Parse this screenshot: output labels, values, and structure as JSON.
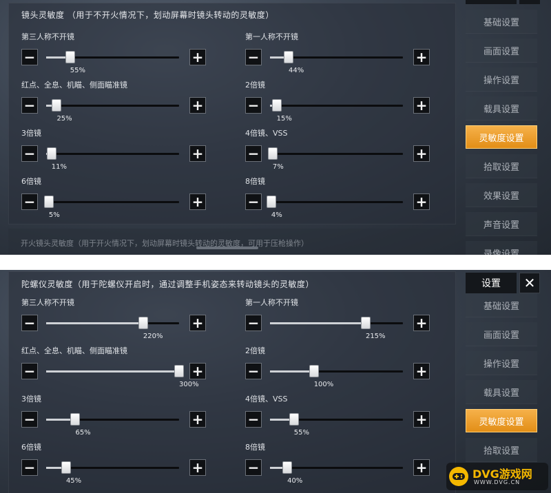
{
  "panel1": {
    "section_title": "镜头灵敏度  （用于不开火情况下，划动屏幕时镜头转动的灵敏度）",
    "next_section_title": "开火镜头灵敏度（用于开火情况下，划动屏幕时镜头转动的灵敏度，可用于压枪操作）",
    "settings": [
      {
        "label": "第三人称不开镜",
        "value": "55%",
        "level": 0.18
      },
      {
        "label": "第一人称不开镜",
        "value": "44%",
        "level": 0.14
      },
      {
        "label": "红点、全息、机瞄、侧面瞄准镜",
        "value": "25%",
        "level": 0.08
      },
      {
        "label": "2倍镜",
        "value": "15%",
        "level": 0.05
      },
      {
        "label": "3倍镜",
        "value": "11%",
        "level": 0.04
      },
      {
        "label": "4倍镜、VSS",
        "value": "7%",
        "level": 0.02
      },
      {
        "label": "6倍镜",
        "value": "5%",
        "level": 0.02
      },
      {
        "label": "8倍镜",
        "value": "4%",
        "level": 0.01
      }
    ],
    "sidebar": [
      {
        "label": "基础设置",
        "active": false
      },
      {
        "label": "画面设置",
        "active": false
      },
      {
        "label": "操作设置",
        "active": false
      },
      {
        "label": "载具设置",
        "active": false
      },
      {
        "label": "灵敏度设置",
        "active": true
      },
      {
        "label": "拾取设置",
        "active": false
      },
      {
        "label": "效果设置",
        "active": false
      },
      {
        "label": "声音设置",
        "active": false
      },
      {
        "label": "录像设置",
        "active": false
      }
    ]
  },
  "panel2": {
    "section_title": "陀螺仪灵敏度（用于陀螺仪开启时，通过调整手机姿态来转动镜头的灵敏度）",
    "header_title": "设置",
    "close_label": "✕",
    "settings": [
      {
        "label": "第三人称不开镜",
        "value": "220%",
        "level": 0.73
      },
      {
        "label": "第一人称不开镜",
        "value": "215%",
        "level": 0.72
      },
      {
        "label": "红点、全息、机瞄、侧面瞄准镜",
        "value": "300%",
        "level": 1.0
      },
      {
        "label": "2倍镜",
        "value": "100%",
        "level": 0.33
      },
      {
        "label": "3倍镜",
        "value": "65%",
        "level": 0.22
      },
      {
        "label": "4倍镜、VSS",
        "value": "55%",
        "level": 0.18
      },
      {
        "label": "6倍镜",
        "value": "45%",
        "level": 0.15
      },
      {
        "label": "8倍镜",
        "value": "40%",
        "level": 0.13
      }
    ],
    "sidebar": [
      {
        "label": "基础设置",
        "active": false
      },
      {
        "label": "画面设置",
        "active": false
      },
      {
        "label": "操作设置",
        "active": false
      },
      {
        "label": "载具设置",
        "active": false
      },
      {
        "label": "灵敏度设置",
        "active": true
      },
      {
        "label": "拾取设置",
        "active": false
      }
    ]
  },
  "controls": {
    "minus": "−",
    "plus": "+"
  },
  "watermark": {
    "text": "DVG游戏网",
    "url": "WWW.DVG.CN"
  },
  "colors": {
    "accent": "#f0a030",
    "track": "#0b0c0e",
    "fill": "#cfd2d6"
  }
}
